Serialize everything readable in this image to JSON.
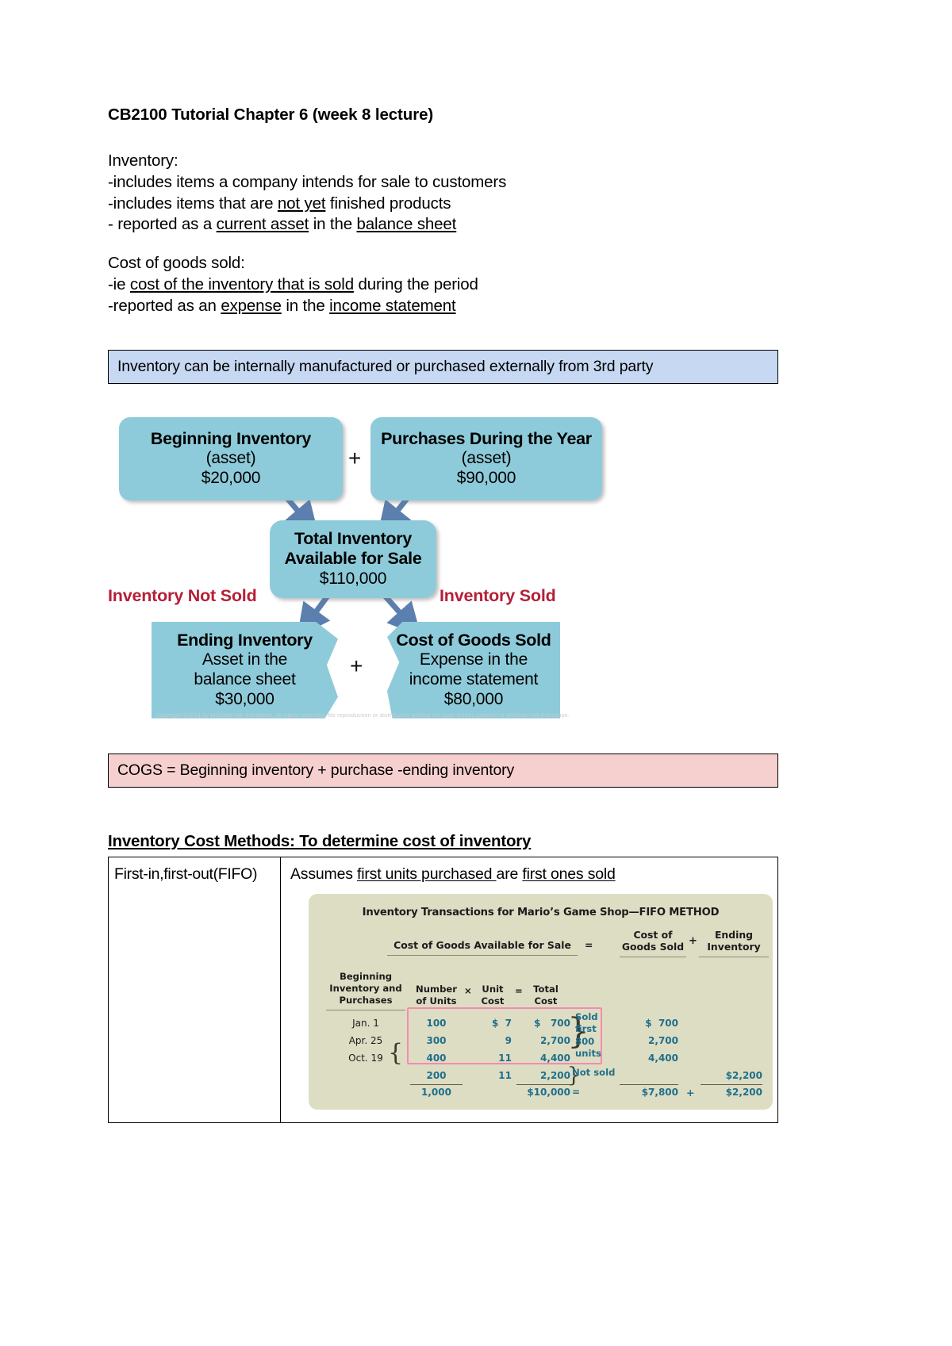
{
  "document": {
    "title": "CB2100 Tutorial Chapter 6 (week 8 lecture)"
  },
  "inventory_notes": {
    "heading": "Inventory:",
    "line1": "-includes items a company intends for sale to customers",
    "line2_a": "-includes items that are ",
    "line2_u": "not yet",
    "line2_b": " finished products",
    "line3_a": "- reported as a ",
    "line3_u1": "current asset",
    "line3_b": " in the ",
    "line3_u2": "balance sheet"
  },
  "cogs_notes": {
    "heading": "Cost of goods sold:",
    "line1_a": "-ie ",
    "line1_u": "cost of the inventory that is sold",
    "line1_b": " during the period",
    "line2_a": "-reported as an ",
    "line2_u1": "expense",
    "line2_b": " in the ",
    "line2_u2": "income statement"
  },
  "callout_blue": {
    "text": "Inventory can be internally manufactured or purchased externally from 3rd party",
    "bg": "#c7d8f2"
  },
  "callout_pink": {
    "text": "COGS = Beginning inventory + purchase -ending inventory",
    "bg": "#f6cfcf"
  },
  "flowchart": {
    "node_bg": "#8ecbda",
    "label_color": "#b51f38",
    "beginning": {
      "title": "Beginning Inventory",
      "sub": "(asset)",
      "amount": "$20,000"
    },
    "purchases": {
      "title": "Purchases During the Year",
      "sub": "(asset)",
      "amount": "$90,000"
    },
    "total": {
      "title_line1": "Total Inventory",
      "title_line2": "Available for Sale",
      "amount": "$110,000"
    },
    "ending": {
      "title": "Ending Inventory",
      "sub1": "Asset in the",
      "sub2": "balance sheet",
      "amount": "$30,000"
    },
    "cogs": {
      "title": "Cost of Goods Sold",
      "sub1": "Expense in the",
      "sub2": "income statement",
      "amount": "$80,000"
    },
    "plus_top": "+",
    "plus_bottom": "+",
    "label_left": "Inventory Not Sold",
    "label_right": "Inventory Sold",
    "faint_caption": "Copyright ©2014 by McGraw-Hill Education. All rights reserved. No reproduction or distribution without the prior written consent of McGraw-Hill Education."
  },
  "methods": {
    "heading": "Inventory Cost Methods: To determine cost of inventory",
    "row_label": "First-in,first-out(FIFO)",
    "assume_a": "Assumes ",
    "assume_u1": "first units purchased ",
    "assume_b": "are ",
    "assume_u2": "first ones sold"
  },
  "figure": {
    "bg": "#ddddc4",
    "accent": "#1f6f8b",
    "highlight_border": "#f58ab0",
    "title": "Inventory Transactions for Mario’s Game Shop—FIFO METHOD",
    "cgafs_header": "Cost of Goods Available for Sale",
    "eq_after_cgafs": "=",
    "cgs_header_line1": "Cost of",
    "cgs_header_line2": "Goods Sold",
    "plus_header": "+",
    "ei_header_line1": "Ending",
    "ei_header_line2": "Inventory",
    "col_beginning_l1": "Beginning",
    "col_beginning_l2": "Inventory and",
    "col_beginning_l3": "Purchases",
    "col_units_l1": "Number",
    "col_units_l2": "of Units",
    "col_x": "×",
    "col_unitcost_l1": "Unit",
    "col_unitcost_l2": "Cost",
    "col_eq": "=",
    "col_totalcost_l1": "Total",
    "col_totalcost_l2": "Cost",
    "sold_first_l1": "Sold",
    "sold_first_l2": "first",
    "sold_first_l3": "800",
    "sold_first_l4": "units",
    "not_sold": "Not sold",
    "eq_bottom": "=",
    "plus_bottom": "+"
  },
  "chart_data": {
    "type": "table",
    "title": "Inventory Transactions for Mario’s Game Shop—FIFO METHOD",
    "columns": [
      "Beginning Inventory and Purchases",
      "Number of Units",
      "Unit Cost",
      "Total Cost",
      "Cost of Goods Sold",
      "Ending Inventory"
    ],
    "rows": [
      {
        "date": "Jan.  1",
        "units": "100",
        "unit_cost": "$  7",
        "total_cost": "$    700",
        "cogs": "$  700",
        "ending": ""
      },
      {
        "date": "Apr. 25",
        "units": "300",
        "unit_cost": "9",
        "total_cost": "2,700",
        "cogs": "2,700",
        "ending": ""
      },
      {
        "date": "",
        "units": "400",
        "unit_cost": "11",
        "total_cost": "4,400",
        "cogs": "4,400",
        "ending": ""
      },
      {
        "date": "Oct. 19",
        "units": "200",
        "unit_cost": "11",
        "total_cost": "2,200",
        "cogs": "",
        "ending": "$2,200"
      }
    ],
    "totals": {
      "units": "1,000",
      "total_cost": "$10,000",
      "cogs": "$7,800",
      "ending": "$2,200"
    },
    "date_oct": "Oct. 19",
    "date_jan": "Jan.  1",
    "date_apr": "Apr. 25",
    "units_col": "100\n300\n400\n200",
    "unitcost_col": "$  7\n9\n11\n11",
    "totalcost_col": "$   700\n2,700\n4,400\n2,200",
    "cogs_col": "$  700\n2,700\n4,400",
    "ending_col": "$2,200"
  }
}
